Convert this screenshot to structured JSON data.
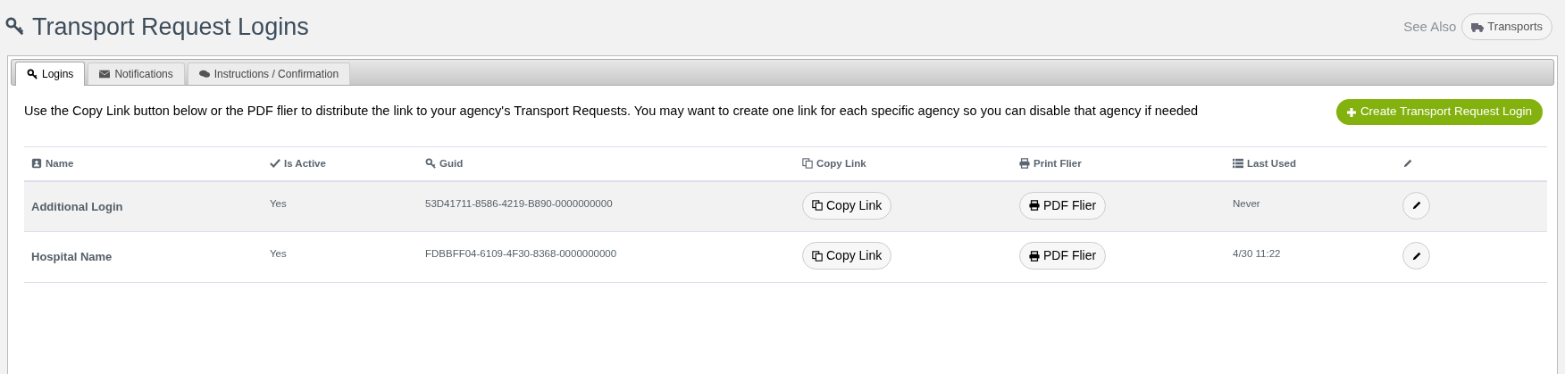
{
  "page": {
    "title": "Transport Request Logins",
    "see_also": "See Also",
    "see_also_button": "Transports"
  },
  "tabs": [
    {
      "label": "Logins",
      "selected": true
    },
    {
      "label": "Notifications",
      "selected": false
    },
    {
      "label": "Instructions / Confirmation",
      "selected": false
    }
  ],
  "description": "Use the Copy Link button below or the PDF flier to distribute the link to your agency's Transport Requests. You may want to create one link for each specific agency so you can disable that agency if needed",
  "create_button": "Create Transport Request Login",
  "table": {
    "columns": [
      {
        "label": "Name"
      },
      {
        "label": "Is Active"
      },
      {
        "label": "Guid"
      },
      {
        "label": "Copy Link"
      },
      {
        "label": "Print Flier"
      },
      {
        "label": "Last Used"
      }
    ],
    "rows": [
      {
        "name": "Additional Login",
        "is_active": "Yes",
        "guid": "53D41711-8586-4219-B890-0000000000",
        "copy_link": "Copy Link",
        "print_flier": "PDF Flier",
        "last_used": "Never",
        "highlighted": true
      },
      {
        "name": "Hospital Name",
        "is_active": "Yes",
        "guid": "FDBBFF04-6109-4F30-8368-0000000000",
        "copy_link": "Copy Link",
        "print_flier": "PDF Flier",
        "last_used": "4/30 11:22",
        "highlighted": false
      }
    ]
  }
}
